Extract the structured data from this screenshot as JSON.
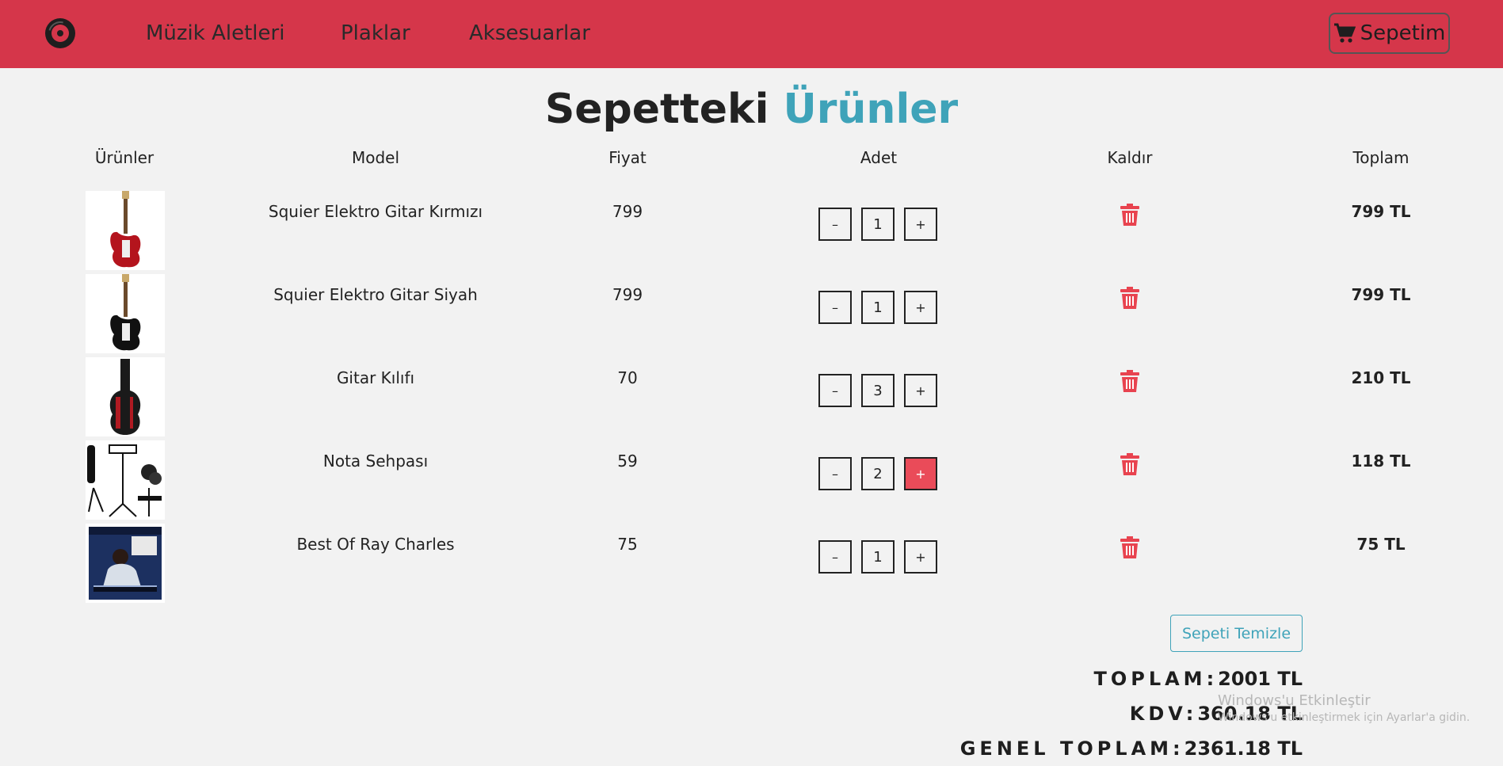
{
  "nav": {
    "links": [
      "Müzik Aletleri",
      "Plaklar",
      "Aksesuarlar"
    ],
    "cart_label": "Sepetim"
  },
  "title": {
    "main": "Sepetteki",
    "accent": "Ürünler"
  },
  "table": {
    "headers": [
      "Ürünler",
      "Model",
      "Fiyat",
      "Adet",
      "Kaldır",
      "Toplam"
    ],
    "rows": [
      {
        "model": "Squier Elektro Gitar Kırmızı",
        "price": "799",
        "qty": "1",
        "total": "799 TL",
        "image": "red-electric-guitar"
      },
      {
        "model": "Squier Elektro Gitar Siyah",
        "price": "799",
        "qty": "1",
        "total": "799 TL",
        "image": "black-electric-guitar"
      },
      {
        "model": "Gitar Kılıfı",
        "price": "70",
        "qty": "3",
        "total": "210 TL",
        "image": "guitar-gig-bag"
      },
      {
        "model": "Nota Sehpası",
        "price": "59",
        "qty": "2",
        "total": "118 TL",
        "image": "music-stand-set"
      },
      {
        "model": "Best Of Ray Charles",
        "price": "75",
        "qty": "1",
        "total": "75 TL",
        "image": "ray-charles-album-cover"
      }
    ],
    "minus_label": "–",
    "plus_label": "+"
  },
  "actions": {
    "clear_cart": "Sepeti Temizle"
  },
  "summary": {
    "subtotal_label": "TOPLAM:",
    "subtotal_value": "2001 TL",
    "tax_label": "KDV:",
    "tax_value": "360.18 TL",
    "grand_label": "GENEL TOPLAM:",
    "grand_value": "2361.18 TL"
  },
  "watermark": {
    "line1": "Windows'u Etkinleştir",
    "line2": "Windows'u etkinleştirmek için Ayarlar'a gidin."
  },
  "colors": {
    "navbar": "#d5364a",
    "accent": "#3fa3b9",
    "danger": "#ea4b59"
  }
}
